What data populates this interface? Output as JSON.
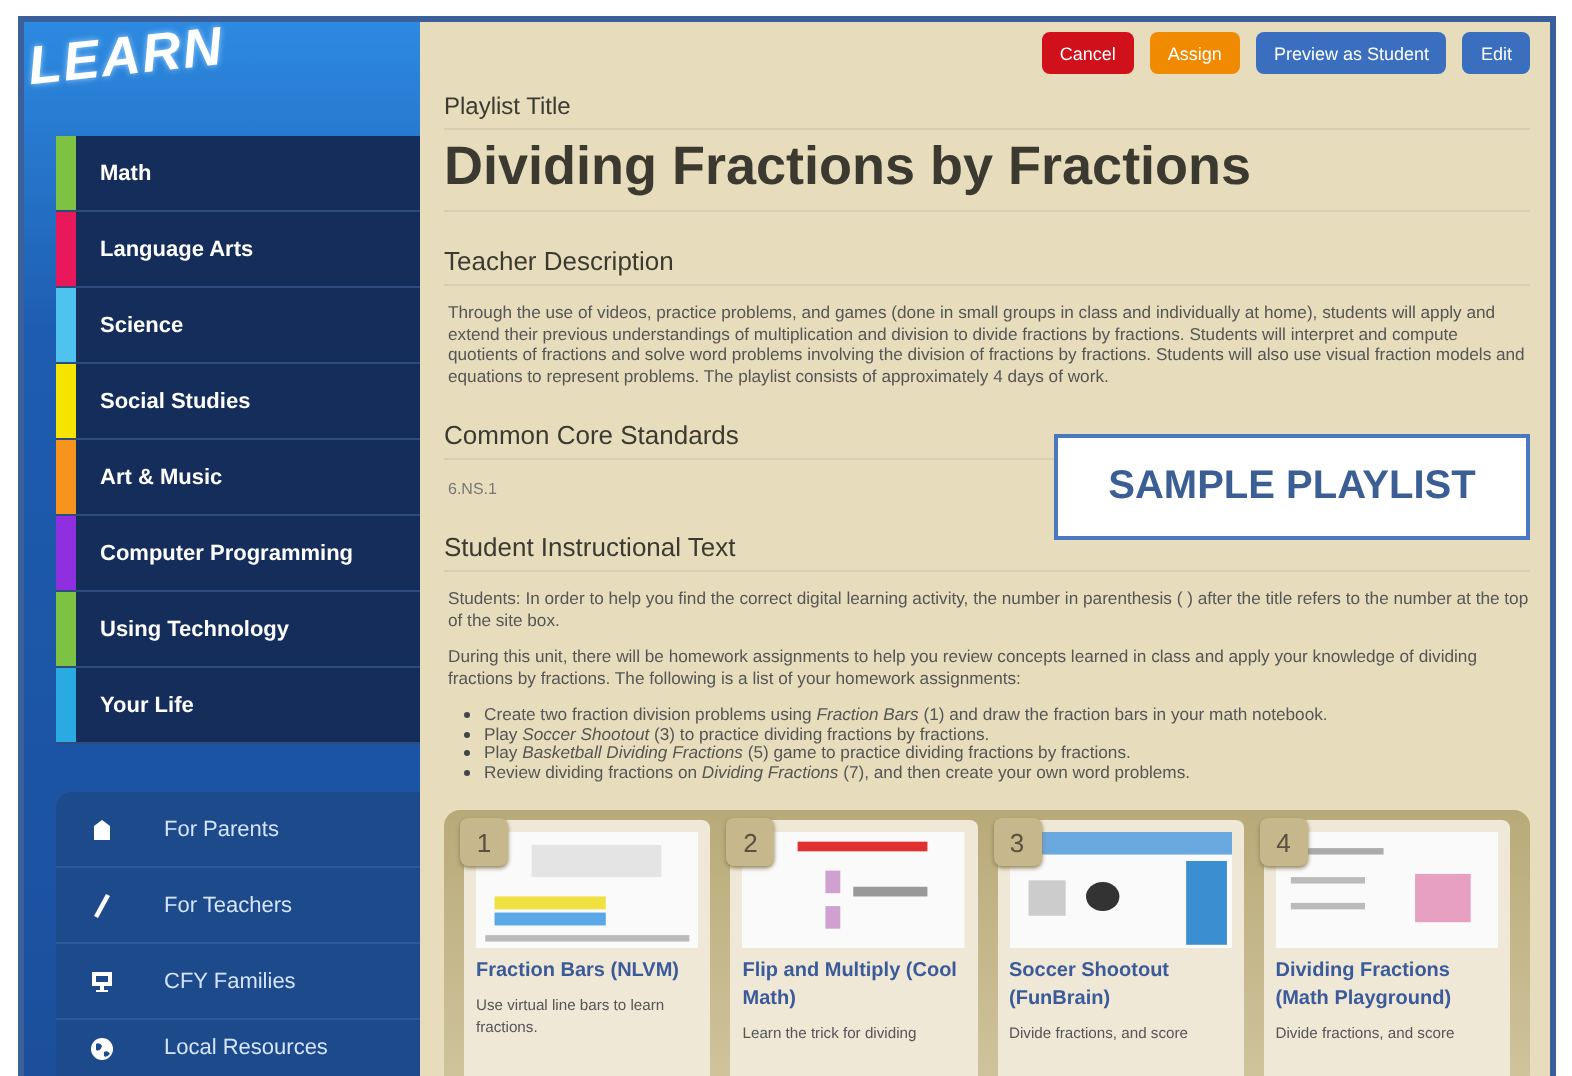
{
  "logo": {
    "text": "LEARN"
  },
  "sidebar": {
    "categories": [
      {
        "label": "Math",
        "color": "#7dc242"
      },
      {
        "label": "Language Arts",
        "color": "#e8185a"
      },
      {
        "label": "Science",
        "color": "#4fc3f0"
      },
      {
        "label": "Social Studies",
        "color": "#f5e400"
      },
      {
        "label": "Art & Music",
        "color": "#f7941d"
      },
      {
        "label": "Computer Programming",
        "color": "#8e2fe0"
      },
      {
        "label": "Using Technology",
        "color": "#7dc242"
      },
      {
        "label": "Your Life",
        "color": "#29abe2"
      }
    ],
    "links": [
      {
        "label": "For Parents"
      },
      {
        "label": "For Teachers"
      },
      {
        "label": "CFY Families"
      },
      {
        "label": "Local Resources"
      }
    ]
  },
  "toolbar": {
    "buttons": [
      {
        "label": "Cancel",
        "kind": "danger"
      },
      {
        "label": "Assign",
        "kind": "warning"
      },
      {
        "label": "Preview as Student",
        "kind": "primary"
      },
      {
        "label": "Edit",
        "kind": "primary"
      }
    ]
  },
  "playlist": {
    "title_label": "Playlist Title",
    "title": "Dividing Fractions by Fractions",
    "teacher_heading": "Teacher Description",
    "teacher_description": "Through the use of videos, practice problems, and games (done in small groups in class and individually at home), students will apply and extend their previous understandings of multiplication and division to divide fractions by fractions. Students will interpret and compute quotients of fractions and solve word problems involving the division of fractions by fractions. Students will also use visual fraction models and equations to represent problems. The playlist consists of approximately 4 days of work.",
    "standards_heading": "Common Core Standards",
    "standards": [
      "6.NS.1"
    ],
    "student_heading": "Student Instructional Text",
    "student_paragraphs": [
      "Students: In order to help you find the correct digital learning activity, the number in parenthesis ( ) after the title refers to the number at the top of the site box.",
      "During this unit, there will be homework assignments to help you review concepts learned in class and apply your knowledge of dividing fractions by fractions. The following is a list of your homework assignments:"
    ],
    "assignments": [
      "Create two fraction division problems using *Fraction Bars* (1) and draw the fraction bars in your math notebook.",
      "Play *Soccer Shootout* (3) to practice dividing fractions by fractions.",
      "Play *Basketball Dividing Fractions* (5) game to practice dividing fractions by fractions.",
      "Review dividing fractions on *Dividing Fractions* (7), and then create your own word problems."
    ],
    "activities": [
      {
        "number": "1",
        "title": "Fraction Bars (NLVM)",
        "description": "Use virtual line bars to learn fractions."
      },
      {
        "number": "2",
        "title": "Flip and Multiply (Cool Math)",
        "description": "Learn the trick for dividing"
      },
      {
        "number": "3",
        "title": "Soccer Shootout (FunBrain)",
        "description": "Divide fractions, and score"
      },
      {
        "number": "4",
        "title": "Dividing Fractions (Math Playground)",
        "description": "Divide fractions, and score"
      }
    ]
  },
  "overlay_label": "SAMPLE PLAYLIST"
}
